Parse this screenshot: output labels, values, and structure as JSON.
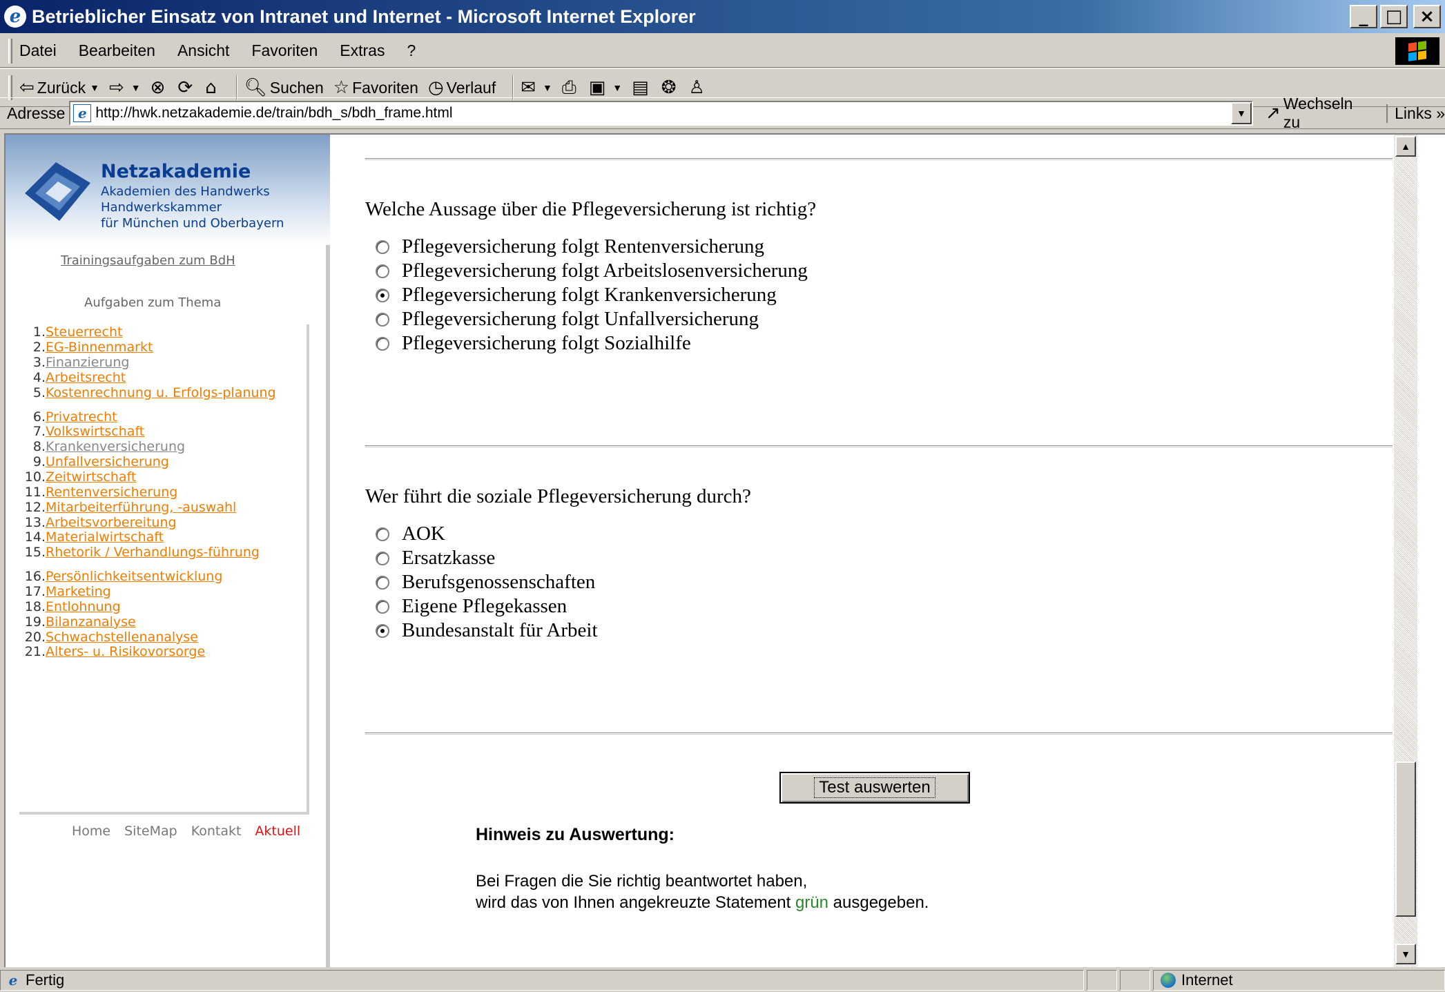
{
  "window": {
    "title": "Betrieblicher Einsatz von Intranet und Internet - Microsoft Internet Explorer",
    "minimize": "_",
    "maximize": "□",
    "close": "×"
  },
  "menu": [
    "Datei",
    "Bearbeiten",
    "Ansicht",
    "Favoriten",
    "Extras",
    "?"
  ],
  "toolbar": {
    "back": "Zurück",
    "search": "Suchen",
    "favorites": "Favoriten",
    "history": "Verlauf"
  },
  "address": {
    "label": "Adresse",
    "url": "http://hwk.netzakademie.de/train/bdh_s/bdh_frame.html",
    "go": "Wechseln zu",
    "links": "Links »"
  },
  "sidebar": {
    "logo_title": "Netzakademie",
    "logo_lines": [
      "Akademien des Handwerks",
      "Handwerkskammer",
      "für München und Oberbayern"
    ],
    "trainings_link": "Trainingsaufgaben zum BdH",
    "topics_heading": "Aufgaben zum Thema",
    "topics": [
      {
        "num": "1.",
        "label": "Steuerrecht",
        "visited": false
      },
      {
        "num": "2.",
        "label": "EG-Binnenmarkt",
        "visited": false
      },
      {
        "num": "3.",
        "label": "Finanzierung",
        "visited": true
      },
      {
        "num": "4.",
        "label": "Arbeitsrecht",
        "visited": false
      },
      {
        "num": "5.",
        "label": "Kostenrechnung u. Erfolgs-planung",
        "visited": false
      },
      {
        "num": "6.",
        "label": "Privatrecht",
        "visited": false
      },
      {
        "num": "7.",
        "label": "Volkswirtschaft",
        "visited": false
      },
      {
        "num": "8.",
        "label": "Krankenversicherung",
        "visited": true
      },
      {
        "num": "9.",
        "label": "Unfallversicherung",
        "visited": false
      },
      {
        "num": "10.",
        "label": "Zeitwirtschaft",
        "visited": false
      },
      {
        "num": "11.",
        "label": "Rentenversicherung",
        "visited": false
      },
      {
        "num": "12.",
        "label": "Mitarbeiterführung, -auswahl",
        "visited": false
      },
      {
        "num": "13.",
        "label": "Arbeitsvorbereitung",
        "visited": false
      },
      {
        "num": "14.",
        "label": "Materialwirtschaft",
        "visited": false
      },
      {
        "num": "15.",
        "label": "Rhetorik / Verhandlungs-führung",
        "visited": false
      },
      {
        "num": "16.",
        "label": "Persönlichkeitsentwicklung",
        "visited": false
      },
      {
        "num": "17.",
        "label": "Marketing",
        "visited": false
      },
      {
        "num": "18.",
        "label": "Entlohnung",
        "visited": false
      },
      {
        "num": "19.",
        "label": "Bilanzanalyse",
        "visited": false
      },
      {
        "num": "20.",
        "label": "Schwachstellenanalyse",
        "visited": false
      },
      {
        "num": "21.",
        "label": "Alters- u. Risikovorsorge",
        "visited": false
      }
    ],
    "footer": {
      "home": "Home",
      "sitemap": "SiteMap",
      "kontakt": "Kontakt",
      "aktuell": "Aktuell"
    }
  },
  "main": {
    "q1": {
      "text": "Welche Aussage über die Pflegeversicherung ist richtig?",
      "options": [
        "Pflegeversicherung folgt Rentenversicherung",
        "Pflegeversicherung folgt Arbeitslosenversicherung",
        "Pflegeversicherung folgt Krankenversicherung",
        "Pflegeversicherung folgt Unfallversicherung",
        "Pflegeversicherung folgt Sozialhilfe"
      ],
      "selected_index": 2
    },
    "q2": {
      "text": "Wer führt die soziale Pflegeversicherung durch?",
      "options": [
        "AOK",
        "Ersatzkasse",
        "Berufsgenossenschaften",
        "Eigene Pflegekassen",
        "Bundesanstalt für Arbeit"
      ],
      "selected_index": 4
    },
    "submit_label": "Test auswerten",
    "hint_title": "Hinweis zu Auswertung:",
    "hint_line1": "Bei Fragen die Sie richtig beantwortet haben,",
    "hint_line2_before": "wird das von Ihnen angekreuzte Statement ",
    "hint_line2_green": "grün",
    "hint_line2_after": " ausgegeben."
  },
  "status": {
    "text": "Fertig",
    "zone": "Internet"
  },
  "colors": {
    "link_orange": "#f07d00",
    "visited_gray": "#888888",
    "aktuell_red": "#e01010",
    "hint_green": "#2a8a2a"
  }
}
